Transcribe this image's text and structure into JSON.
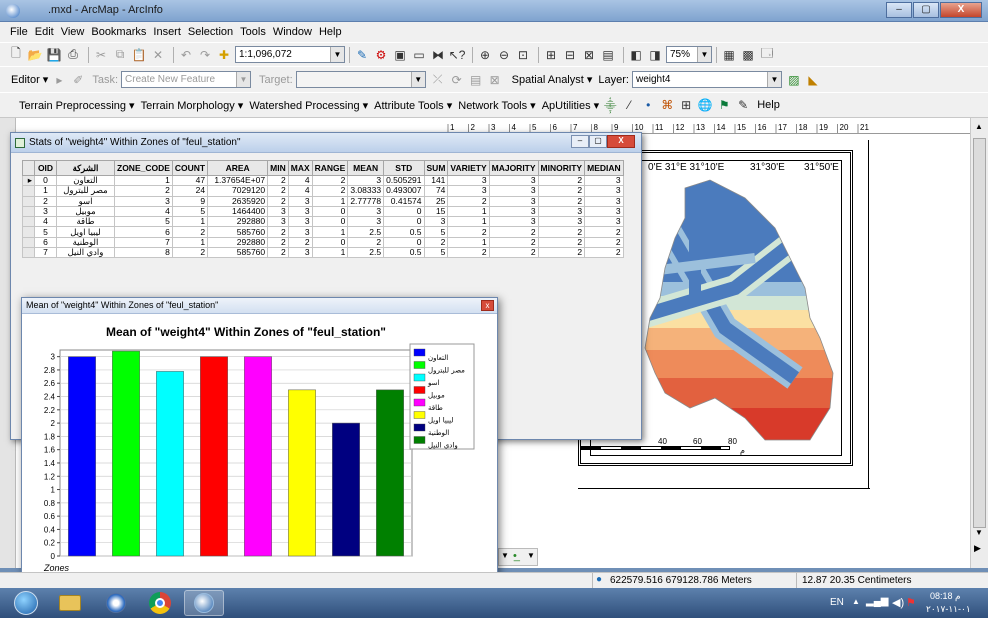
{
  "window": {
    "title": ".mxd - ArcMap - ArcInfo",
    "controls": [
      "–",
      "▢",
      "X"
    ]
  },
  "menu": [
    "File",
    "Edit",
    "View",
    "Bookmarks",
    "Insert",
    "Selection",
    "Tools",
    "Window",
    "Help"
  ],
  "toolbar": {
    "scale": "1:1,096,072",
    "zoom": "75%",
    "editor_label": "Editor ▾",
    "task_label": "Task:",
    "task_value": "Create New Feature",
    "target_label": "Target:",
    "spatial_analyst": "Spatial Analyst ▾",
    "layer_label": "Layer:",
    "layer_value": "weight4",
    "arc_menus": [
      "Terrain Preprocessing ▾",
      "Terrain Morphology ▾",
      "Watershed Processing ▾",
      "Attribute Tools ▾",
      "Network Tools ▾",
      "ApUtilities ▾"
    ],
    "help_label": "Help"
  },
  "ruler": {
    "ticks": [
      "1",
      "2",
      "3",
      "4",
      "5",
      "6",
      "7",
      "8",
      "9",
      "10",
      "11",
      "12",
      "13",
      "14",
      "15",
      "16",
      "17",
      "18",
      "19",
      "20",
      "21"
    ]
  },
  "map": {
    "coords_top": [
      "0'E 31°E 31°10'E",
      "31°30'E",
      "31°50'E"
    ],
    "scale_labels": [
      "40",
      "60",
      "80"
    ],
    "scale_unit": "م"
  },
  "stats_window": {
    "title": "Stats of \"weight4\" Within Zones of \"feul_station\"",
    "columns": [
      "OID",
      "الشركة",
      "ZONE_CODE",
      "COUNT",
      "AREA",
      "MIN",
      "MAX",
      "RANGE",
      "MEAN",
      "STD",
      "SUM",
      "VARIETY",
      "MAJORITY",
      "MINORITY",
      "MEDIAN"
    ],
    "rows": [
      [
        "0",
        "التعاون",
        "1",
        "47",
        "1.37654E+07",
        "2",
        "4",
        "2",
        "3",
        "0.505291",
        "141",
        "3",
        "3",
        "2",
        "3"
      ],
      [
        "1",
        "مصر للبترول",
        "2",
        "24",
        "7029120",
        "2",
        "4",
        "2",
        "3.08333",
        "0.493007",
        "74",
        "3",
        "3",
        "2",
        "3"
      ],
      [
        "2",
        "اسو",
        "3",
        "9",
        "2635920",
        "2",
        "3",
        "1",
        "2.77778",
        "0.41574",
        "25",
        "2",
        "3",
        "2",
        "3"
      ],
      [
        "3",
        "موبيل",
        "4",
        "5",
        "1464400",
        "3",
        "3",
        "0",
        "3",
        "0",
        "15",
        "1",
        "3",
        "3",
        "3"
      ],
      [
        "4",
        "طاقة",
        "5",
        "1",
        "292880",
        "3",
        "3",
        "0",
        "3",
        "0",
        "3",
        "1",
        "3",
        "3",
        "3"
      ],
      [
        "5",
        "ليبيا اويل",
        "6",
        "2",
        "585760",
        "2",
        "3",
        "1",
        "2.5",
        "0.5",
        "5",
        "2",
        "2",
        "2",
        "2"
      ],
      [
        "6",
        "الوطنية",
        "7",
        "1",
        "292880",
        "2",
        "2",
        "0",
        "2",
        "0",
        "2",
        "1",
        "2",
        "2",
        "2"
      ],
      [
        "7",
        "وادي النيل",
        "8",
        "2",
        "585760",
        "2",
        "3",
        "1",
        "2.5",
        "0.5",
        "5",
        "2",
        "2",
        "2",
        "2"
      ]
    ]
  },
  "chart_window": {
    "title": "Mean of \"weight4\" Within Zones of \"feul_station\""
  },
  "chart_data": {
    "type": "bar",
    "title": "Mean of \"weight4\" Within Zones of \"feul_station\"",
    "xlabel": "Zones",
    "ylabel": "",
    "ylim": [
      0,
      3.1
    ],
    "yticks": [
      "0",
      "0.2",
      "0.4",
      "0.6",
      "0.8",
      "1",
      "1.2",
      "1.4",
      "1.6",
      "1.8",
      "2",
      "2.2",
      "2.4",
      "2.6",
      "2.8",
      "3"
    ],
    "grid": true,
    "legend": "right",
    "categories": [
      "التعاون",
      "مصر للبترول",
      "اسو",
      "موبيل",
      "طاقة",
      "ليبيا اويل",
      "الوطنية",
      "وادي النيل"
    ],
    "values": [
      3,
      3.08333,
      2.77778,
      3,
      3,
      2.5,
      2,
      2.5
    ],
    "colors": [
      "#0000ff",
      "#00ff00",
      "#00ffff",
      "#ff0000",
      "#ff00ff",
      "#ffff00",
      "#000080",
      "#008000"
    ]
  },
  "status": {
    "coords": "622579.516  679128.786 Meters",
    "page": "12.87  20.35 Centimeters"
  },
  "taskbar": {
    "lang": "EN",
    "time": "08:18 م",
    "date": "٠١-١١-٢٠١٧"
  }
}
